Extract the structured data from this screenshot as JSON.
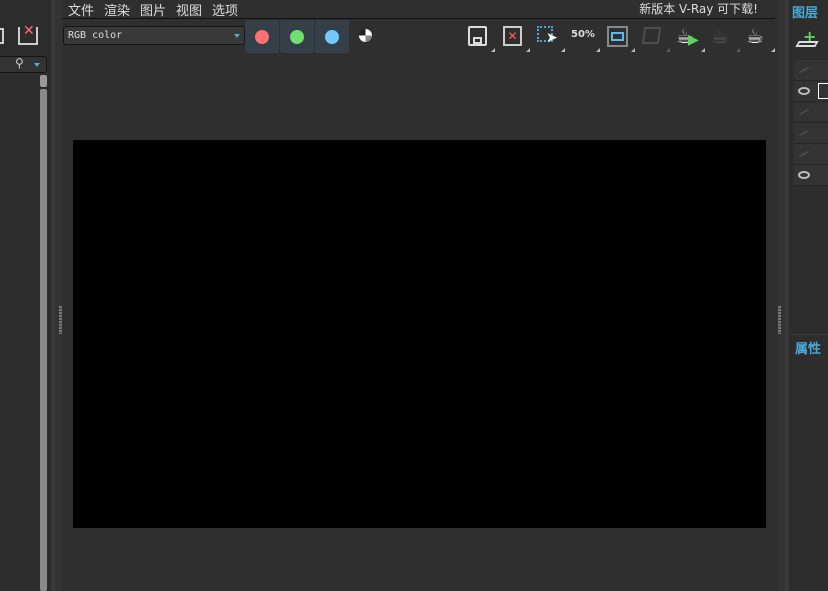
{
  "menu": [
    "文件",
    "渲染",
    "图片",
    "视图",
    "选项"
  ],
  "notice": "新版本 V-Ray 可下载!",
  "channel_select": {
    "value": "RGB color"
  },
  "channels": [
    {
      "name": "red",
      "color": "#ff7070"
    },
    {
      "name": "green",
      "color": "#70e070"
    },
    {
      "name": "blue",
      "color": "#70c8ff"
    }
  ],
  "toolbar": [
    "save-icon",
    "clear-image-icon",
    "region-render-icon",
    "zoom-50-icon",
    "frame-icon",
    "track-mouse-icon",
    "render-interactive-icon",
    "stop-render-icon",
    "render-icon"
  ],
  "zoom_label": "50%",
  "right_panel": {
    "layers_tab": "图层",
    "properties_tab": "属性"
  },
  "layers": [
    {
      "visible": false
    },
    {
      "visible": true
    },
    {
      "visible": false
    },
    {
      "visible": false
    },
    {
      "visible": false
    },
    {
      "visible": true
    }
  ]
}
